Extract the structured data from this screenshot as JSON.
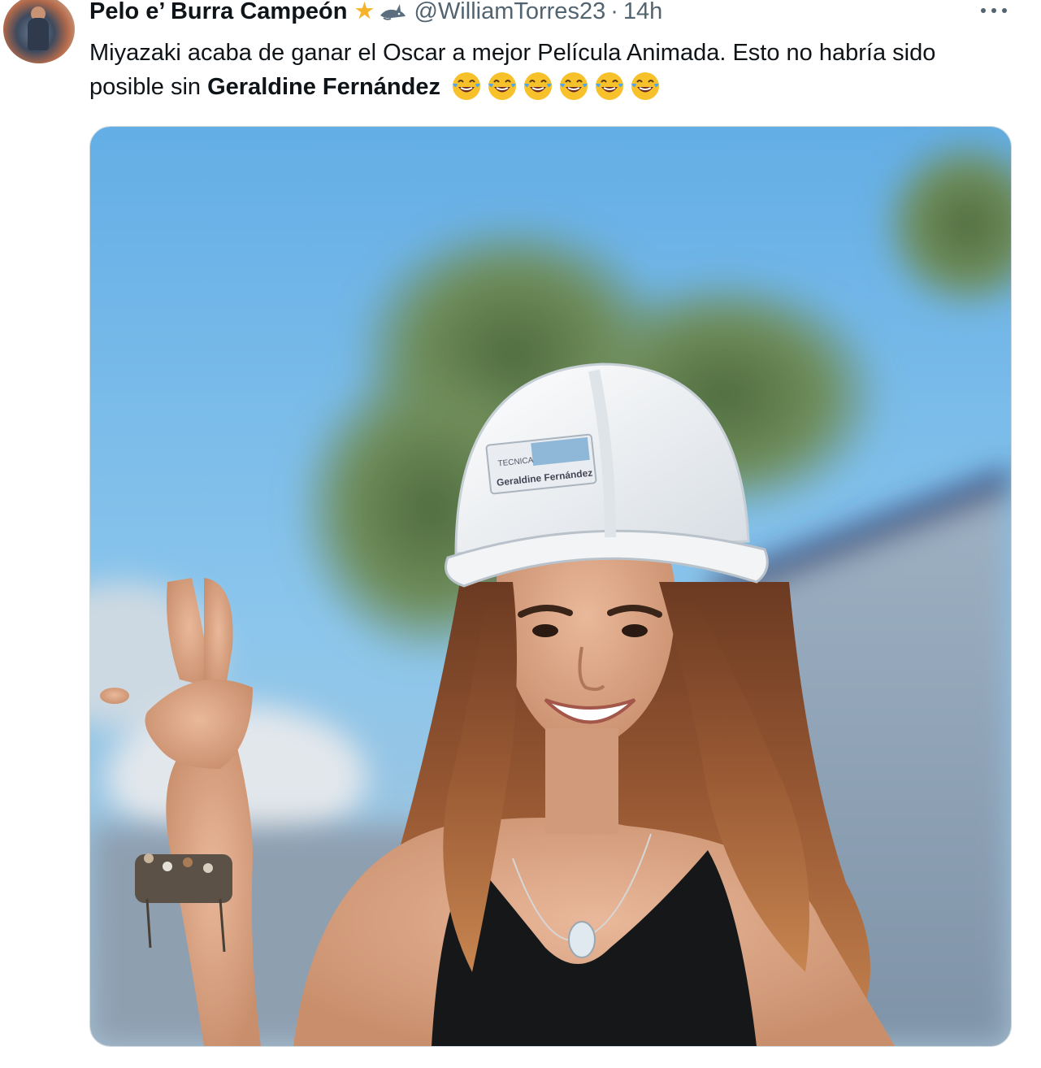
{
  "tweet": {
    "author_name": "Pelo e’ Burra Campeón",
    "badge_icons": [
      "star-icon",
      "shark-icon"
    ],
    "handle": "@WilliamTorres23",
    "separator": "·",
    "time": "14h",
    "text_before": "Miyazaki acaba de ganar el Oscar a mejor Película Animada. Esto no habría sido posible sin ",
    "text_bold": "Geraldine Fernández",
    "emoji_count": 6,
    "emoji_name": "tears-of-joy-emoji",
    "photo": {
      "subject": "woman-in-white-hard-hat-peace-sign",
      "helmet_label_line1": "TECNICA",
      "helmet_label_line2": "Geraldine Fernández"
    }
  },
  "colors": {
    "text_primary": "#0f1419",
    "text_secondary": "#536471",
    "star": "#f5b32b",
    "sky": "#6fb6e8"
  }
}
